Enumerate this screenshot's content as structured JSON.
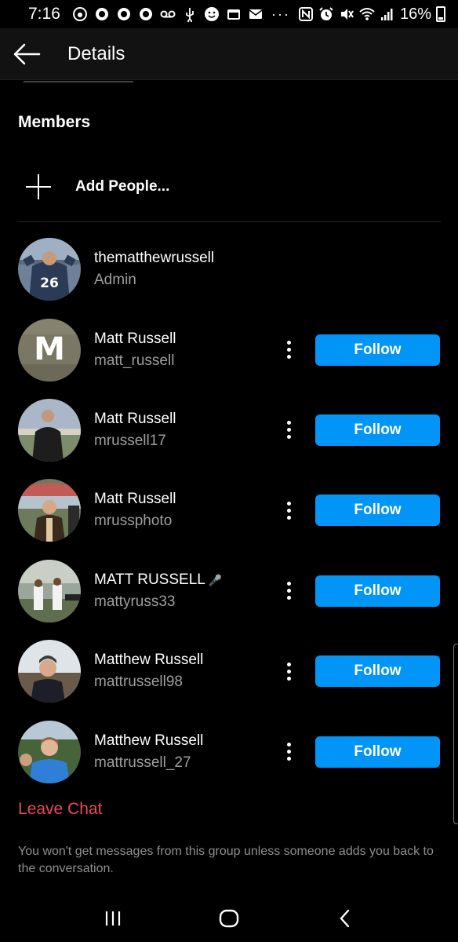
{
  "status_bar": {
    "time": "7:16",
    "battery": "16%",
    "left_icons": [
      "app-icon",
      "circle-icon",
      "circle-icon",
      "circle-icon",
      "voicemail-icon",
      "usb-icon",
      "face-icon",
      "calendar-icon",
      "mail-icon"
    ],
    "dots": "···",
    "right_icons": [
      "nfc-icon",
      "alarm-icon",
      "mute-icon",
      "wifi-icon",
      "signal-icon"
    ]
  },
  "header": {
    "title": "Details",
    "back_icon": "arrow-left-icon"
  },
  "members_section": {
    "title": "Members",
    "add_label": "Add People...",
    "add_icon": "plus-icon"
  },
  "members": [
    {
      "name": "thematthewrussell",
      "subtitle": "Admin",
      "show_follow": false
    },
    {
      "name": "Matt Russell",
      "subtitle": "matt_russell",
      "show_follow": true,
      "follow_label": "Follow"
    },
    {
      "name": "Matt Russell",
      "subtitle": "mrussell17",
      "show_follow": true,
      "follow_label": "Follow"
    },
    {
      "name": "Matt Russell",
      "subtitle": "mrussphoto",
      "show_follow": true,
      "follow_label": "Follow"
    },
    {
      "name": "MATT RUSSELL",
      "subtitle": "mattyruss33",
      "show_follow": true,
      "follow_label": "Follow",
      "emoji": "microphone-icon"
    },
    {
      "name": "Matthew Russell",
      "subtitle": "mattrussell98",
      "show_follow": true,
      "follow_label": "Follow"
    },
    {
      "name": "Matthew Russell",
      "subtitle": "mattrussell_27",
      "show_follow": true,
      "follow_label": "Follow"
    }
  ],
  "avatar_letter": "M",
  "leave": {
    "label": "Leave Chat",
    "note": "You won't get messages from this group unless someone adds you back to the conversation."
  },
  "nav": {
    "recents_icon": "recents-icon",
    "home_icon": "home-icon",
    "back_icon": "back-chevron-icon"
  },
  "colors": {
    "accent": "#0095f6",
    "danger": "#ed4956",
    "background": "#000000",
    "header_bg": "#121212",
    "secondary_text": "#9e9e9e"
  }
}
